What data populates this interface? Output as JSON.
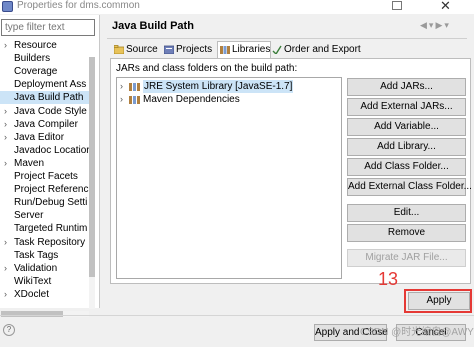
{
  "window": {
    "title": "Properties for dms.common",
    "close_glyph": "✕",
    "app_icon": "eclipse-icon"
  },
  "left_nav": {
    "filter_placeholder": "type filter text",
    "items": [
      {
        "label": "Resource",
        "expandable": true
      },
      {
        "label": "Builders",
        "expandable": false
      },
      {
        "label": "Coverage",
        "expandable": false
      },
      {
        "label": "Deployment Ass",
        "expandable": false
      },
      {
        "label": "Java Build Path",
        "expandable": false,
        "selected": true
      },
      {
        "label": "Java Code Style",
        "expandable": true
      },
      {
        "label": "Java Compiler",
        "expandable": true
      },
      {
        "label": "Java Editor",
        "expandable": true
      },
      {
        "label": "Javadoc Locatior",
        "expandable": false
      },
      {
        "label": "Maven",
        "expandable": true
      },
      {
        "label": "Project Facets",
        "expandable": false
      },
      {
        "label": "Project Referenc",
        "expandable": false
      },
      {
        "label": "Run/Debug Setti",
        "expandable": false
      },
      {
        "label": "Server",
        "expandable": false
      },
      {
        "label": "Targeted Runtim",
        "expandable": false
      },
      {
        "label": "Task Repository",
        "expandable": true
      },
      {
        "label": "Task Tags",
        "expandable": false
      },
      {
        "label": "Validation",
        "expandable": true
      },
      {
        "label": "WikiText",
        "expandable": false
      },
      {
        "label": "XDoclet",
        "expandable": true
      }
    ]
  },
  "main": {
    "title": "Java Build Path",
    "tabs": [
      {
        "label": "Source",
        "icon": "source-folder-icon"
      },
      {
        "label": "Projects",
        "icon": "projects-icon"
      },
      {
        "label": "Libraries",
        "icon": "libraries-icon",
        "active": true
      },
      {
        "label": "Order and Export",
        "icon": "order-export-icon"
      }
    ],
    "jars_label": "JARs and class folders on the build path:",
    "jar_entries": [
      {
        "label": "JRE System Library [JavaSE-1.7]",
        "icon": "library-icon",
        "selected": true
      },
      {
        "label": "Maven Dependencies",
        "icon": "library-icon",
        "selected": false
      }
    ],
    "buttons": [
      {
        "label": "Add JARs...",
        "enabled": true
      },
      {
        "label": "Add External JARs...",
        "enabled": true
      },
      {
        "label": "Add Variable...",
        "enabled": true
      },
      {
        "label": "Add Library...",
        "enabled": true
      },
      {
        "label": "Add Class Folder...",
        "enabled": true
      },
      {
        "label": "Add External Class Folder...",
        "enabled": true
      },
      {
        "label": "Edit...",
        "enabled": true
      },
      {
        "label": "Remove",
        "enabled": true
      },
      {
        "label": "Migrate JAR File...",
        "enabled": false
      }
    ]
  },
  "annotation": {
    "step_number": "13",
    "color": "#e53935"
  },
  "footer": {
    "apply_label": "Apply",
    "apply_close_label": "Apply and Close",
    "cancel_label": "Cancel",
    "watermark": "CSDN @时光编自@AWY"
  },
  "colors": {
    "selection": "#cce4f7",
    "button_face": "#e1e1e1",
    "highlight_box": "#e53935"
  }
}
